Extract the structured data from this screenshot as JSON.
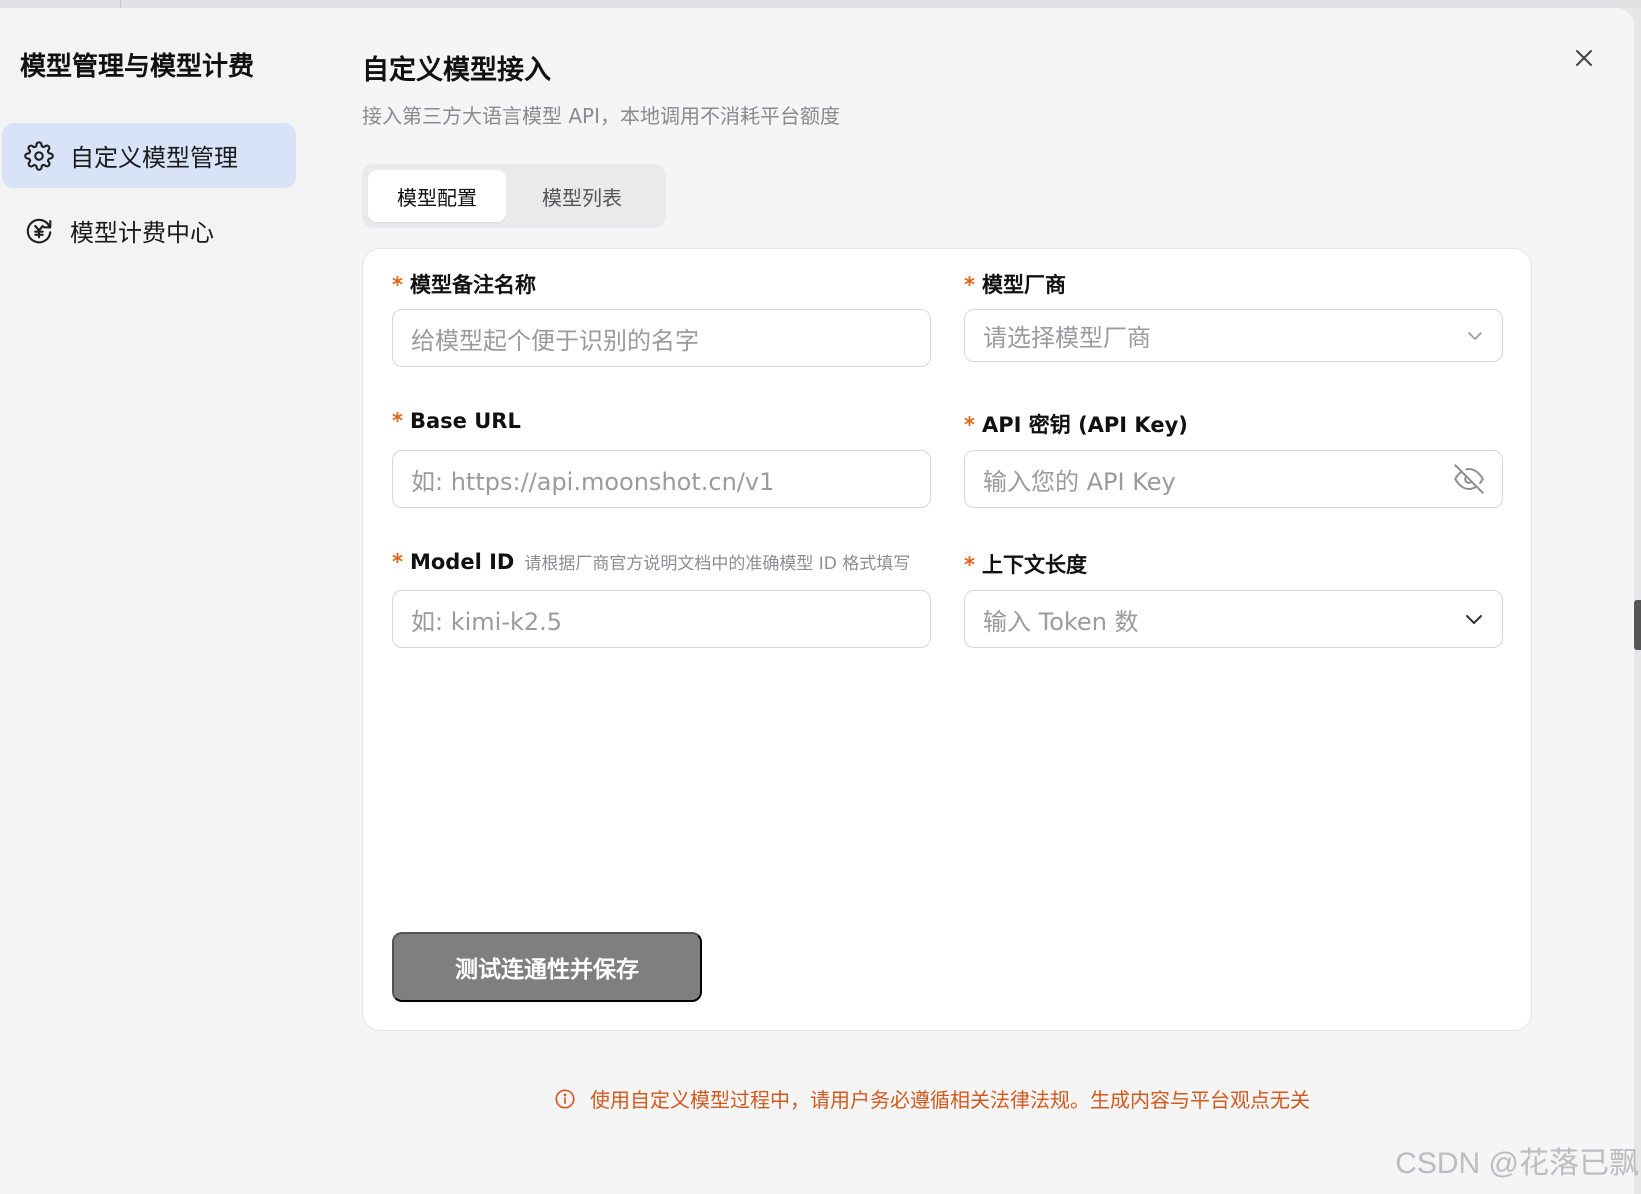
{
  "sidebar": {
    "title": "模型管理与模型计费",
    "items": [
      {
        "label": "自定义模型管理",
        "icon": "gear-icon",
        "active": true
      },
      {
        "label": "模型计费中心",
        "icon": "yuan-refresh-icon",
        "active": false
      }
    ]
  },
  "header": {
    "title": "自定义模型接入",
    "subtitle": "接入第三方大语言模型 API，本地调用不消耗平台额度",
    "close_icon": "close-icon"
  },
  "tabs": [
    {
      "label": "模型配置",
      "active": true
    },
    {
      "label": "模型列表",
      "active": false
    }
  ],
  "form": {
    "required_mark": "*",
    "model_name": {
      "label": "模型备注名称",
      "placeholder": "给模型起个便于识别的名字"
    },
    "vendor": {
      "label": "模型厂商",
      "placeholder": "请选择模型厂商"
    },
    "base_url": {
      "label": "Base URL",
      "placeholder": "如: https://api.moonshot.cn/v1"
    },
    "api_key": {
      "label": "API 密钥 (API Key)",
      "placeholder": "输入您的 API Key"
    },
    "model_id": {
      "label": "Model ID",
      "hint": "请根据厂商官方说明文档中的准确模型 ID 格式填写",
      "placeholder": "如: kimi-k2.5"
    },
    "context_length": {
      "label": "上下文长度",
      "placeholder": "输入 Token 数"
    },
    "submit_label": "测试连通性并保存"
  },
  "footer": {
    "notice": "使用自定义模型过程中，请用户务必遵循相关法律法规。生成内容与平台观点无关"
  },
  "watermark": "CSDN @花落已飘",
  "colors": {
    "accent_active_nav": "#d8e3f7",
    "required": "#e0651c",
    "notice": "#d2591e",
    "button_disabled": "#7f7f7f"
  }
}
